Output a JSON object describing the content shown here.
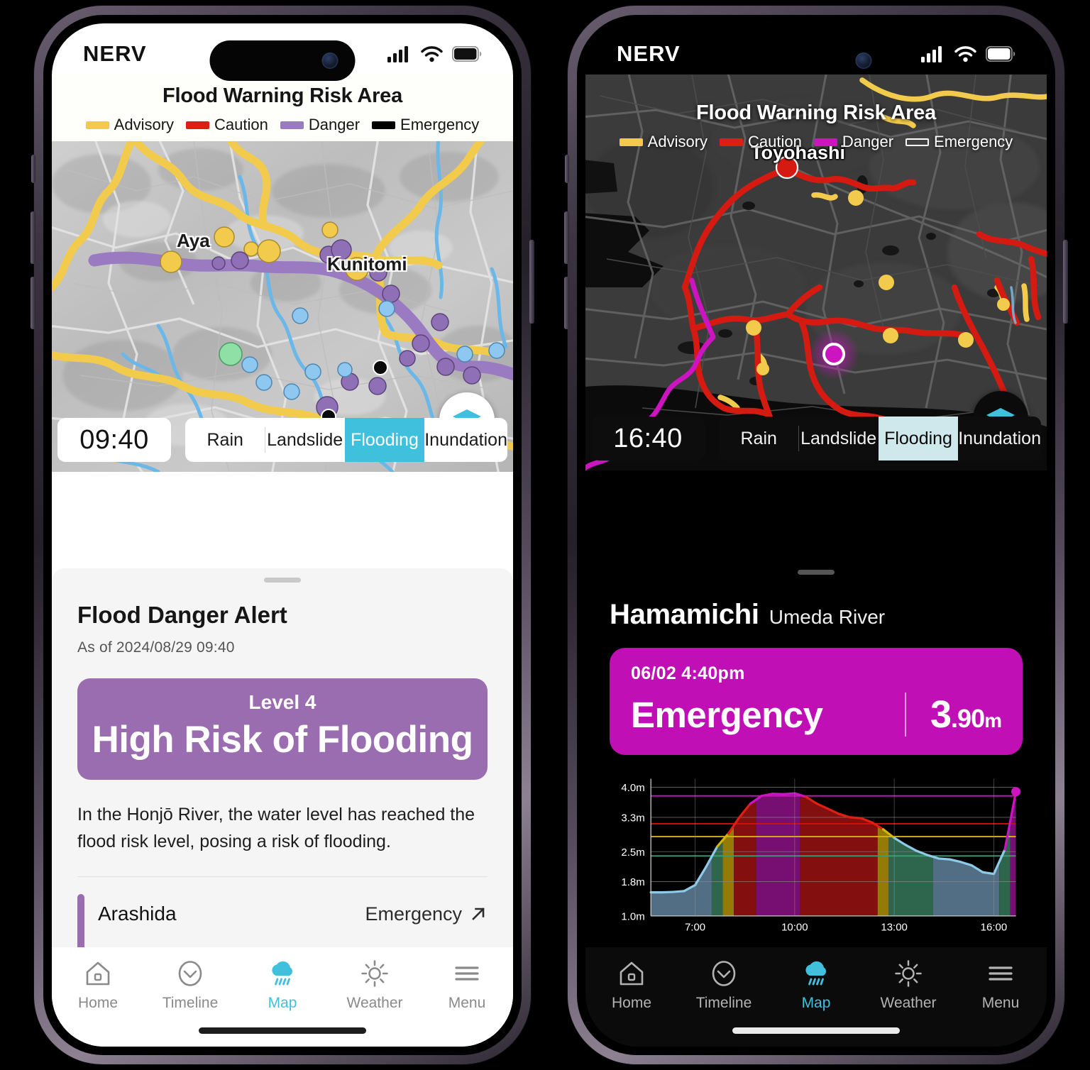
{
  "left_phone": {
    "theme": "light",
    "status_bar": {
      "brand": "NERV",
      "signal_icon": "cellular-signal-icon",
      "wifi_icon": "wifi-icon",
      "battery_icon": "battery-icon"
    },
    "map_header": {
      "title": "Flood Warning Risk Area",
      "legend": [
        {
          "label": "Advisory",
          "color": "#f2cb4d",
          "style": "solid"
        },
        {
          "label": "Caution",
          "color": "#dd1f13",
          "style": "solid"
        },
        {
          "label": "Danger",
          "color": "#9a7bc2",
          "style": "solid"
        },
        {
          "label": "Emergency",
          "color": "#000000",
          "style": "solid"
        }
      ]
    },
    "map": {
      "place_labels": [
        "Aya",
        "Kunitomi"
      ],
      "layers_button_icon": "layers-icon",
      "base_color": "#c6c6c6",
      "river_colors": {
        "advisory": "#f2cb4d",
        "danger": "#9a7bc2",
        "normal": "#6bb7e8"
      }
    },
    "time_chip": "09:40",
    "tabs": [
      {
        "label": "Rain",
        "active": false
      },
      {
        "label": "Landslide",
        "active": false
      },
      {
        "label": "Flooding",
        "active": true
      },
      {
        "label": "Inundation",
        "active": false
      }
    ],
    "sheet": {
      "title": "Flood Danger Alert",
      "subtitle": "As of 2024/08/29  09:40",
      "level_badge": {
        "level": "Level 4",
        "headline": "High Risk of Flooding",
        "color": "#9a6cb0"
      },
      "body": "In the Honjō River, the water level has reached the flood risk level, posing a risk of flooding.",
      "river_item": {
        "name": "Arashida",
        "status": "Emergency",
        "arrow_icon": "arrow-up-right-icon",
        "bar_color": "#9a6cb0"
      }
    },
    "tabbar": [
      {
        "label": "Home",
        "icon": "home-icon",
        "active": false
      },
      {
        "label": "Timeline",
        "icon": "clock-check-icon",
        "active": false
      },
      {
        "label": "Map",
        "icon": "rain-cloud-icon",
        "active": true
      },
      {
        "label": "Weather",
        "icon": "sun-icon",
        "active": false
      },
      {
        "label": "Menu",
        "icon": "hamburger-menu-icon",
        "active": false
      }
    ]
  },
  "right_phone": {
    "theme": "dark",
    "status_bar": {
      "brand": "NERV",
      "signal_icon": "cellular-signal-icon",
      "wifi_icon": "wifi-icon",
      "battery_icon": "battery-icon"
    },
    "map_header": {
      "title": "Flood Warning Risk Area",
      "legend": [
        {
          "label": "Advisory",
          "color": "#f2cb4d",
          "style": "solid"
        },
        {
          "label": "Caution",
          "color": "#dd1f13",
          "style": "solid"
        },
        {
          "label": "Danger",
          "color": "#cc14c0",
          "style": "solid"
        },
        {
          "label": "Emergency",
          "color": "#ffffff",
          "style": "outline"
        }
      ]
    },
    "map": {
      "place_labels": [
        "Toyohashi"
      ],
      "layers_button_icon": "layers-icon",
      "base_color": "#3a3a3a",
      "selected_marker": {
        "color": "#cc14c0",
        "ring": "#ffffff"
      }
    },
    "time_chip": "16:40",
    "tabs": [
      {
        "label": "Rain",
        "active": false
      },
      {
        "label": "Landslide",
        "active": false
      },
      {
        "label": "Flooding",
        "active": true
      },
      {
        "label": "Inundation",
        "active": false
      }
    ],
    "detail": {
      "station": "Hamamichi",
      "river": "Umeda River",
      "card": {
        "timestamp": "06/02  4:40pm",
        "status": "Emergency",
        "value_int": "3",
        "value_dec": ".90",
        "value_unit": "m",
        "color": "#c00fb4"
      }
    },
    "tabbar": [
      {
        "label": "Home",
        "icon": "home-icon",
        "active": false
      },
      {
        "label": "Timeline",
        "icon": "clock-check-icon",
        "active": false
      },
      {
        "label": "Map",
        "icon": "rain-cloud-icon",
        "active": true
      },
      {
        "label": "Weather",
        "icon": "sun-icon",
        "active": false
      },
      {
        "label": "Menu",
        "icon": "hamburger-menu-icon",
        "active": false
      }
    ]
  },
  "chart_data": {
    "type": "area",
    "title": "",
    "xlabel": "",
    "ylabel": "",
    "x": [
      "5:40",
      "6:00",
      "6:20",
      "6:40",
      "7:00",
      "7:20",
      "7:40",
      "8:00",
      "8:20",
      "8:40",
      "9:00",
      "9:20",
      "9:40",
      "10:00",
      "10:20",
      "10:40",
      "11:00",
      "11:20",
      "11:40",
      "12:00",
      "12:20",
      "12:40",
      "13:00",
      "13:20",
      "13:40",
      "14:00",
      "14:20",
      "14:40",
      "15:00",
      "15:20",
      "15:40",
      "16:00",
      "16:20",
      "16:40"
    ],
    "values": [
      1.55,
      1.55,
      1.56,
      1.58,
      1.72,
      2.15,
      2.62,
      2.92,
      3.3,
      3.62,
      3.8,
      3.85,
      3.84,
      3.86,
      3.78,
      3.62,
      3.5,
      3.38,
      3.3,
      3.28,
      3.18,
      3.02,
      2.82,
      2.66,
      2.52,
      2.42,
      2.34,
      2.32,
      2.26,
      2.18,
      2.02,
      1.98,
      2.55,
      3.9
    ],
    "xticks": [
      "7:00",
      "10:00",
      "13:00",
      "16:00"
    ],
    "yticks": [
      "4.0m",
      "3.3m",
      "2.5m",
      "1.8m",
      "1.0m"
    ],
    "ylim": [
      1.0,
      4.2
    ],
    "grid": true,
    "legend": "none",
    "thresholds": [
      {
        "name": "Emergency",
        "value": 3.8,
        "color": "#cc14c0"
      },
      {
        "name": "Danger",
        "value": 3.15,
        "color": "#cc1111"
      },
      {
        "name": "Caution",
        "value": 2.85,
        "color": "#d6b40b"
      },
      {
        "name": "Advisory",
        "value": 2.4,
        "color": "#3f9c72"
      }
    ],
    "series_line_colors": {
      "normal": "#8ecbe8",
      "caution": "#d6b40b",
      "danger": "#e01f13",
      "emergency": "#cc14c0"
    },
    "current_point": {
      "x": "16:40",
      "y": 3.9,
      "color": "#cc14c0"
    }
  }
}
